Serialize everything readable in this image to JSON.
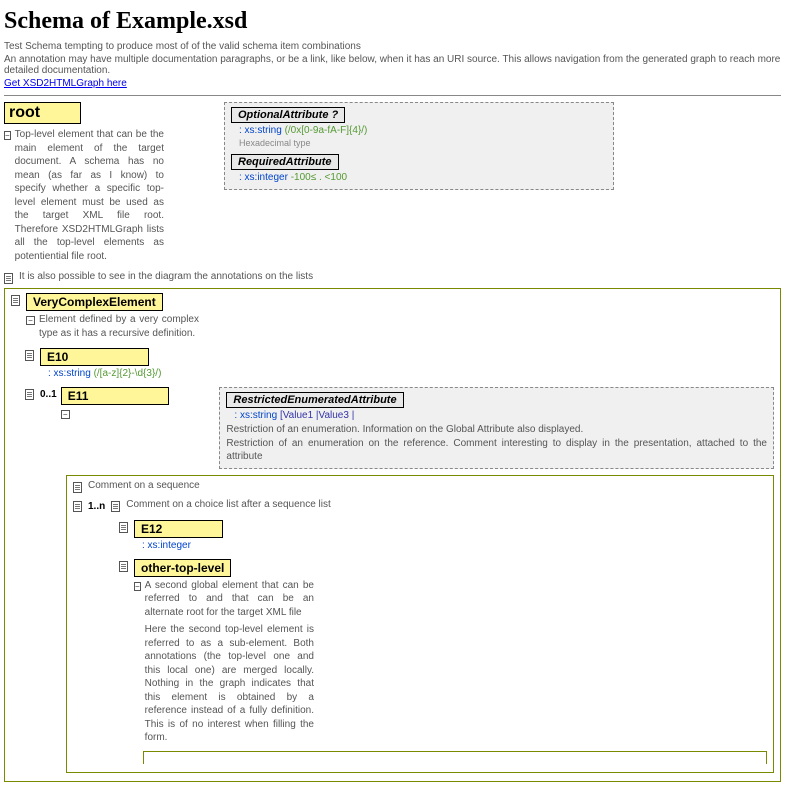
{
  "header": {
    "title": "Schema of Example.xsd",
    "p1": "Test Schema tempting to produce most of of the valid schema item combinations",
    "p2": "An annotation may have multiple documentation paragraphs, or be a link, like below, when it has an URI source. This allows navigation from the generated graph to reach more detailed documentation.",
    "link": "Get XSD2HTMLGraph here"
  },
  "root": {
    "name": "root",
    "desc": "Top-level element that can be the main element of the target document. A schema has no mean (as far as I know) to specify whether a specific top-level element must be used as the target XML file root. Therefore XSD2HTMLGraph lists all the top-level elements as potentiential file root."
  },
  "attrs": {
    "optional": {
      "label": "OptionalAttribute ?",
      "type": ": xs:string",
      "pattern": "(/0x[0-9a-fA-F]{4}/)",
      "note": "Hexadecimal type"
    },
    "required": {
      "label": "RequiredAttribute",
      "type": ": xs:integer",
      "range": "-100≤ . <100"
    }
  },
  "listNote": "It is also possible to see in the diagram the annotations on the lists",
  "vce": {
    "name": "VeryComplexElement",
    "desc": "Element defined by a very complex type as it has a recursive definition."
  },
  "e10": {
    "name": "E10",
    "type": ": xs:string",
    "pattern": "(/[a-z]{2}-\\d{3}/)"
  },
  "e11": {
    "occur": "0..1",
    "name": "E11"
  },
  "rea": {
    "label": "RestrictedEnumeratedAttribute",
    "type": ": xs:string",
    "enum": "[Value1 |Value3 |",
    "d1": "Restriction of an enumeration. Information on the Global Attribute also displayed.",
    "d2": "Restriction of an enumeration on the reference. Comment interesting to display in the presentation, attached to the attribute"
  },
  "seq": {
    "c1": "Comment on a sequence",
    "occur": "1..n",
    "c2": "Comment on a choice list after a sequence list"
  },
  "e12": {
    "name": "E12",
    "type": ": xs:integer"
  },
  "otl": {
    "name": "other-top-level",
    "d1": "A second global element that can be referred to and that can be an alternate root for the target XML file",
    "d2": "Here the second top-level element is referred to as a sub-element. Both annotations (the top-level one and this local one) are merged locally. Nothing in the graph indicates that this element is obtained by a reference instead of a fully definition. This is of no interest when filling the form."
  }
}
